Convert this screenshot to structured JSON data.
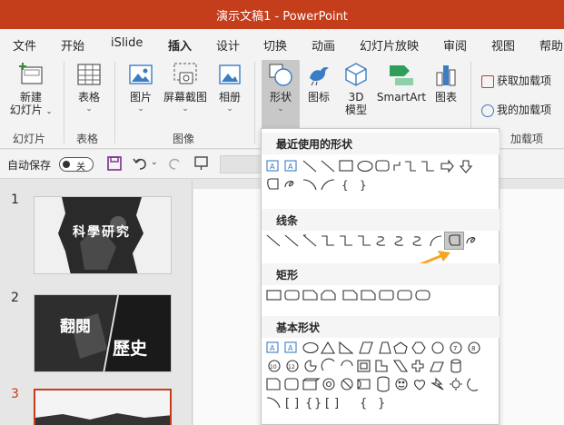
{
  "window": {
    "title": "演示文稿1 - PowerPoint"
  },
  "tabs": [
    {
      "label": "文件"
    },
    {
      "label": "开始"
    },
    {
      "label": "iSlide"
    },
    {
      "label": "插入"
    },
    {
      "label": "设计"
    },
    {
      "label": "切换"
    },
    {
      "label": "动画"
    },
    {
      "label": "幻灯片放映"
    },
    {
      "label": "审阅"
    },
    {
      "label": "视图"
    },
    {
      "label": "帮助"
    }
  ],
  "ribbon": {
    "new_slide": {
      "line1": "新建",
      "line2": "幻灯片"
    },
    "table": "表格",
    "picture": "图片",
    "screenshot": "屏幕截图",
    "album": "相册",
    "shapes": "形状",
    "icons": "图标",
    "model3d": {
      "line1": "3D",
      "line2": "模型"
    },
    "smartart": "SmartArt",
    "chart": "图表",
    "get_addins": "获取加载项",
    "my_addins": "我的加载项",
    "groups": {
      "slides": "幻灯片",
      "tables": "表格",
      "images": "图像",
      "addins": "加载项"
    }
  },
  "qat": {
    "autosave": "自动保存",
    "toggle": "关"
  },
  "thumbnails": [
    {
      "num": "1",
      "text": "科學研究"
    },
    {
      "num": "2",
      "text1": "翻閱",
      "text2": "歷史"
    },
    {
      "num": "3"
    }
  ],
  "dropdown": {
    "recent": "最近使用的形状",
    "lines": "线条",
    "rect": "矩形",
    "basic": "基本形状"
  },
  "colors": {
    "accent": "#c43e1c",
    "arrow": "#f5a623"
  }
}
